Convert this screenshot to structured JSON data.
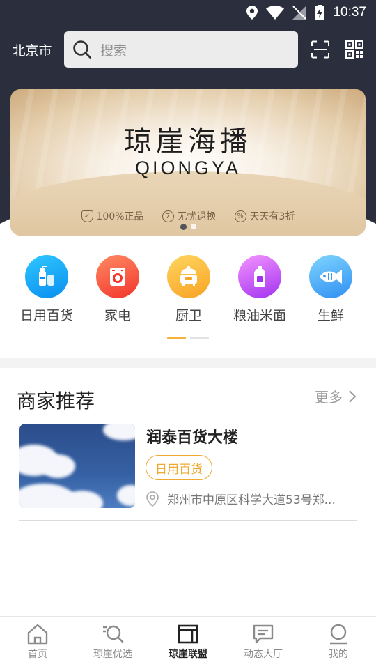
{
  "status_bar": {
    "time": "10:37"
  },
  "header": {
    "city": "北京市",
    "search_placeholder": "搜索"
  },
  "banner": {
    "title_cn": "琼崖海播",
    "title_en": "QIONGYA",
    "features": [
      {
        "icon": "shield-check-icon",
        "symbol": "✓",
        "label": "100%正品"
      },
      {
        "icon": "seven-day-icon",
        "symbol": "7",
        "label": "无忧退换"
      },
      {
        "icon": "percent-icon",
        "symbol": "%",
        "label": "天天有3折"
      }
    ],
    "page_count": 2,
    "active_page": 1
  },
  "categories": [
    {
      "label": "日用百货",
      "icon": "daily-goods-icon",
      "color_from": "#2fc7ff",
      "color_to": "#0a8ef0"
    },
    {
      "label": "家电",
      "icon": "washing-machine-icon",
      "color_from": "#ff8a63",
      "color_to": "#f2352c"
    },
    {
      "label": "厨卫",
      "icon": "rice-cooker-icon",
      "color_from": "#ffd55e",
      "color_to": "#f7a325"
    },
    {
      "label": "粮油米面",
      "icon": "oil-bottle-icon",
      "color_from": "#f494ff",
      "color_to": "#a132f0"
    },
    {
      "label": "生鲜",
      "icon": "fish-icon",
      "color_from": "#7fd5ff",
      "color_to": "#2f8ff2"
    }
  ],
  "merchant_section": {
    "title": "商家推荐",
    "more_label": "更多",
    "shops": [
      {
        "name": "润泰百货大楼",
        "tag": "日用百货",
        "address": "郑州市中原区科学大道53号郑..."
      }
    ]
  },
  "bottom_nav": [
    {
      "label": "首页",
      "icon": "home-icon",
      "active": false
    },
    {
      "label": "琼崖优选",
      "icon": "search-list-icon",
      "active": false
    },
    {
      "label": "琼崖联盟",
      "icon": "alliance-icon",
      "active": true
    },
    {
      "label": "动态大厅",
      "icon": "message-icon",
      "active": false
    },
    {
      "label": "我的",
      "icon": "profile-icon",
      "active": false
    }
  ],
  "colors": {
    "header_bg": "#2b2f3d",
    "accent": "#f5b33c",
    "tag_orange": "#f0a930"
  }
}
